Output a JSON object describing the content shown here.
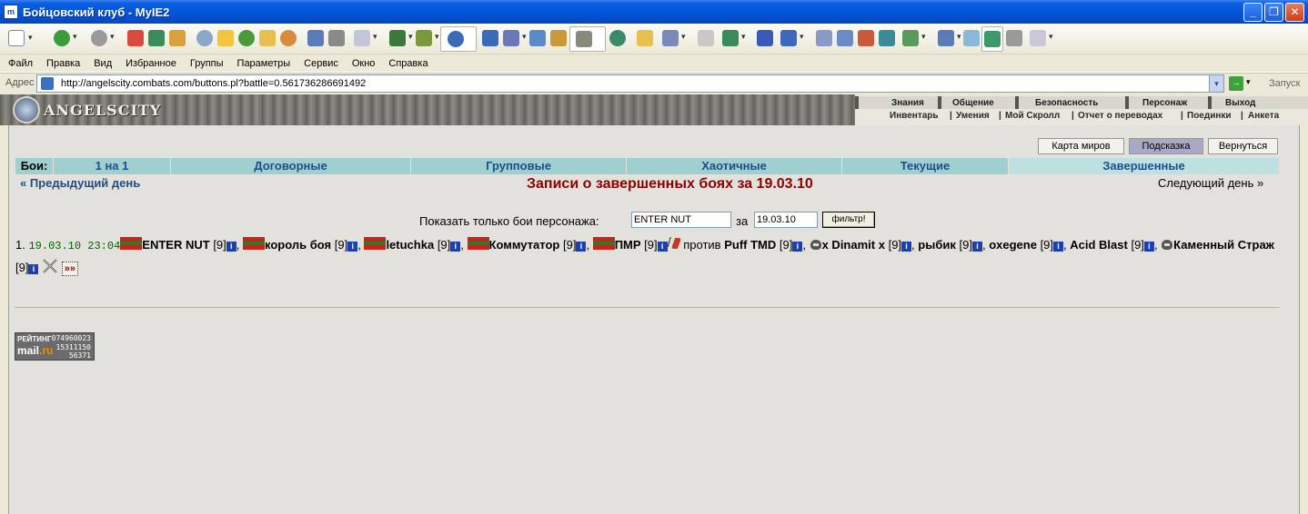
{
  "window": {
    "app_icon": "m",
    "title": "Бойцовский клуб - MyIE2",
    "minimize": "_",
    "maximize": "❐",
    "close": "✕"
  },
  "menu": [
    "Файл",
    "Правка",
    "Вид",
    "Избранное",
    "Группы",
    "Параметры",
    "Сервис",
    "Окно",
    "Справка"
  ],
  "address": {
    "label": "Адрес",
    "url": "http://angelscity.combats.com/buttons.pl?battle=0.561736286691492",
    "go_label": "Запуск"
  },
  "site": {
    "logo_text": "ANGELSCITY",
    "nav_top": [
      "Знания",
      "Общение",
      "Безопасность",
      "Персонаж",
      "Выход"
    ],
    "nav_bottom": [
      "Инвентарь",
      "Умения",
      "Мой Скролл",
      "Отчет о переводах",
      "Поединки",
      "Анкета"
    ]
  },
  "buttons": {
    "world_map": "Карта миров",
    "hint": "Подсказка",
    "back": "Вернуться"
  },
  "tabs": {
    "label": "Бои:",
    "items": [
      "1 на 1",
      "Договорные",
      "Групповые",
      "Хаотичные",
      "Текущие",
      "Завершенные"
    ],
    "active": "Завершенные"
  },
  "page": {
    "prev_day": "« Предыдущий день",
    "heading": "Записи о завершенных боях за 19.03.10",
    "next_day": "Следующий день »"
  },
  "filter": {
    "label": "Показать только бои персонажа:",
    "name_value": "ENTER NUT",
    "za": "за",
    "date_value": "19.03.10",
    "button": "фильтр!"
  },
  "battle": {
    "number": "1.",
    "time": "19.03.10 23:04",
    "team1": [
      {
        "name": "ENTER NUT",
        "level": "[9]"
      },
      {
        "name": "король боя",
        "level": "[9]"
      },
      {
        "name": "letuchka",
        "level": "[9]"
      },
      {
        "name": "Коммутатор",
        "level": "[9]"
      },
      {
        "name": "ПМР",
        "level": "[9]"
      }
    ],
    "vs": "против",
    "team2": [
      {
        "name": "Puff TMD",
        "level": "[9]"
      },
      {
        "name": "x Dinamit x",
        "level": "[9]"
      },
      {
        "name": "рыбик",
        "level": "[9]"
      },
      {
        "name": "oxegene",
        "level": "[9]"
      },
      {
        "name": "Acid Blast",
        "level": "[9]"
      },
      {
        "name": "Каменный Страж",
        "level": "[9]"
      }
    ],
    "more": "»»"
  },
  "counter": {
    "label": "РЕЙТИНГ",
    "logo_main": "mail",
    "logo_suffix": ".ru",
    "values": [
      "074960023",
      "15311150",
      "56371"
    ]
  },
  "icons": {
    "info": "i",
    "nav_down": "▾",
    "go": "→"
  },
  "colors": {
    "tab_bg": "#9fcfcf",
    "tab_text": "#1c4e8a",
    "heading": "#8b0000",
    "time": "#006400"
  }
}
